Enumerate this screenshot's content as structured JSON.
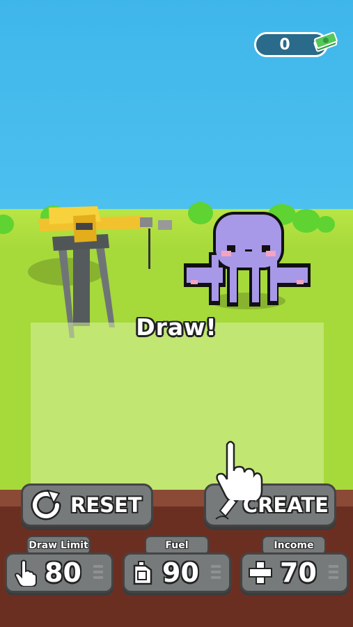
{
  "header": {
    "coins": "0",
    "cash_icon": "cash-stack-icon"
  },
  "scene": {
    "prompt": "Draw!"
  },
  "actions": {
    "reset_label": "RESET",
    "create_label": "CREATE"
  },
  "stats": [
    {
      "label": "Draw Limit",
      "value": "80",
      "icon": "hand-pointer-icon"
    },
    {
      "label": "Fuel",
      "value": "90",
      "icon": "fuel-can-icon"
    },
    {
      "label": "Income",
      "value": "70",
      "icon": "plus-icon"
    }
  ],
  "colors": {
    "sky": "#3fb6ea",
    "grass": "#a6d93a",
    "dirt": "#6b2f22",
    "button": "#767a7b",
    "octopus": "#a898e8"
  }
}
